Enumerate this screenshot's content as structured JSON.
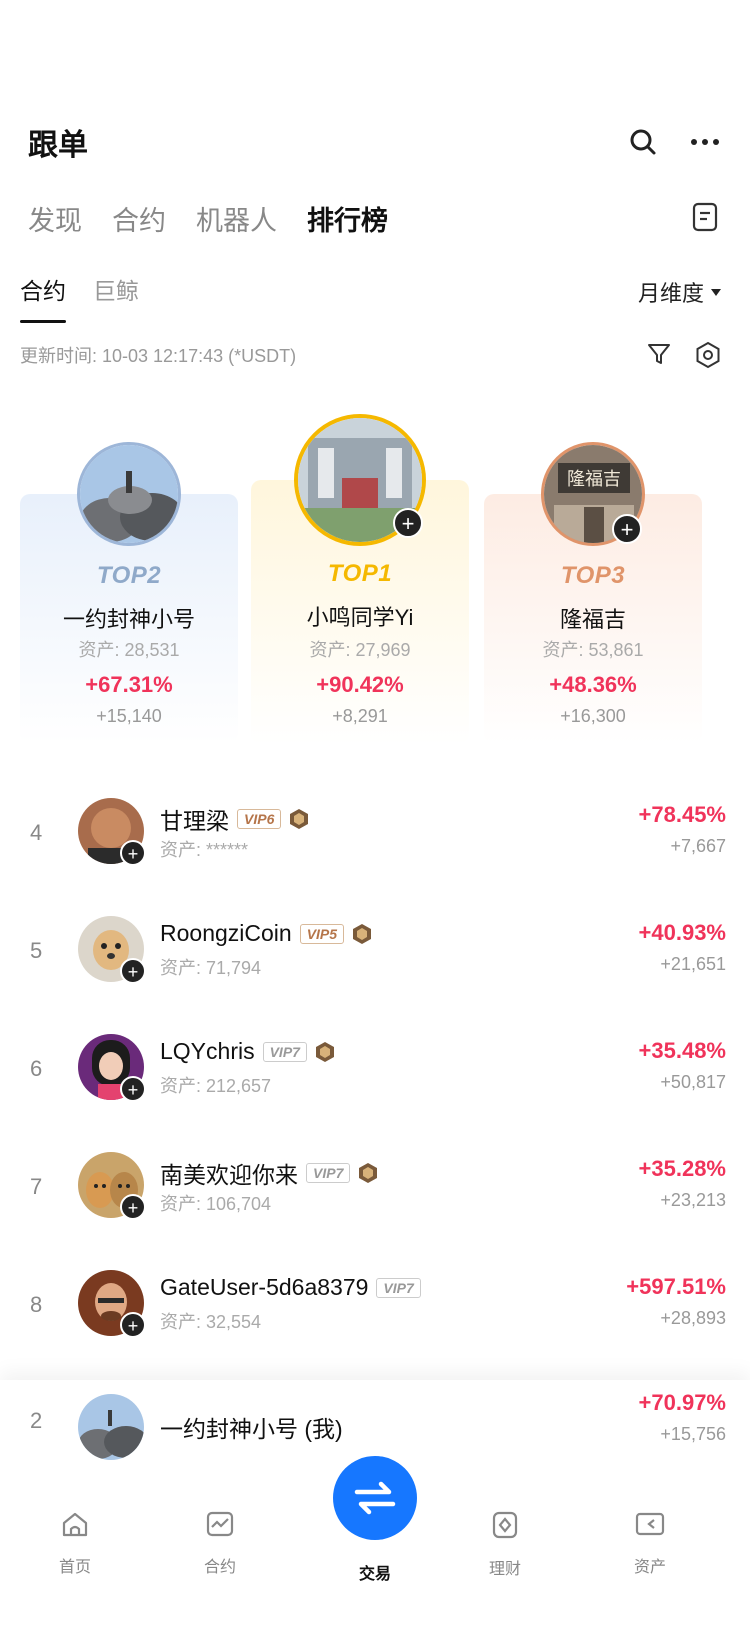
{
  "header": {
    "title": "跟单"
  },
  "main_tabs": [
    {
      "label": "发现"
    },
    {
      "label": "合约"
    },
    {
      "label": "机器人"
    },
    {
      "label": "排行榜"
    }
  ],
  "sub_tabs": [
    {
      "label": "合约"
    },
    {
      "label": "巨鲸"
    }
  ],
  "period": "月维度",
  "update_time": "更新时间: 10-03 12:17:43 (*USDT)",
  "podium": {
    "top1": {
      "rank": "TOP1",
      "name": "小鸣同学Yi",
      "assets": "资产: 27,969",
      "pct": "+90.42%",
      "gain": "+8,291"
    },
    "top2": {
      "rank": "TOP2",
      "name": "一约封神小号",
      "assets": "资产: 28,531",
      "pct": "+67.31%",
      "gain": "+15,140"
    },
    "top3": {
      "rank": "TOP3",
      "name": "隆福吉",
      "assets": "资产: 53,861",
      "pct": "+48.36%",
      "gain": "+16,300",
      "avatar_text": "隆福吉"
    }
  },
  "rows": [
    {
      "num": "4",
      "name": "甘理梁",
      "vip": "VIP6",
      "assets": "资产: ******",
      "pct": "+78.45%",
      "gain": "+7,667"
    },
    {
      "num": "5",
      "name": "RoongziCoin",
      "vip": "VIP5",
      "assets": "资产: 71,794",
      "pct": "+40.93%",
      "gain": "+21,651"
    },
    {
      "num": "6",
      "name": "LQYchris",
      "vip": "VIP7",
      "assets": "资产: 212,657",
      "pct": "+35.48%",
      "gain": "+50,817"
    },
    {
      "num": "7",
      "name": "南美欢迎你来",
      "vip": "VIP7",
      "assets": "资产: 106,704",
      "pct": "+35.28%",
      "gain": "+23,213"
    },
    {
      "num": "8",
      "name": "GateUser-5d6a8379",
      "vip": "VIP7",
      "assets": "资产: 32,554",
      "pct": "+597.51%",
      "gain": "+28,893"
    }
  ],
  "my_row": {
    "num": "2",
    "name": "一约封神小号 (我)",
    "pct": "+70.97%",
    "gain": "+15,756"
  },
  "tabbar": [
    {
      "label": "首页",
      "icon": "home-icon"
    },
    {
      "label": "合约",
      "icon": "contract-icon"
    },
    {
      "label": "交易",
      "icon": "swap-icon"
    },
    {
      "label": "理财",
      "icon": "finance-icon"
    },
    {
      "label": "资产",
      "icon": "assets-icon"
    }
  ],
  "colors": {
    "accent": "#1677ff",
    "positive": "#f0335a",
    "gold": "#f5b800",
    "silver": "#8fa9c9",
    "bronze": "#e0946a"
  }
}
